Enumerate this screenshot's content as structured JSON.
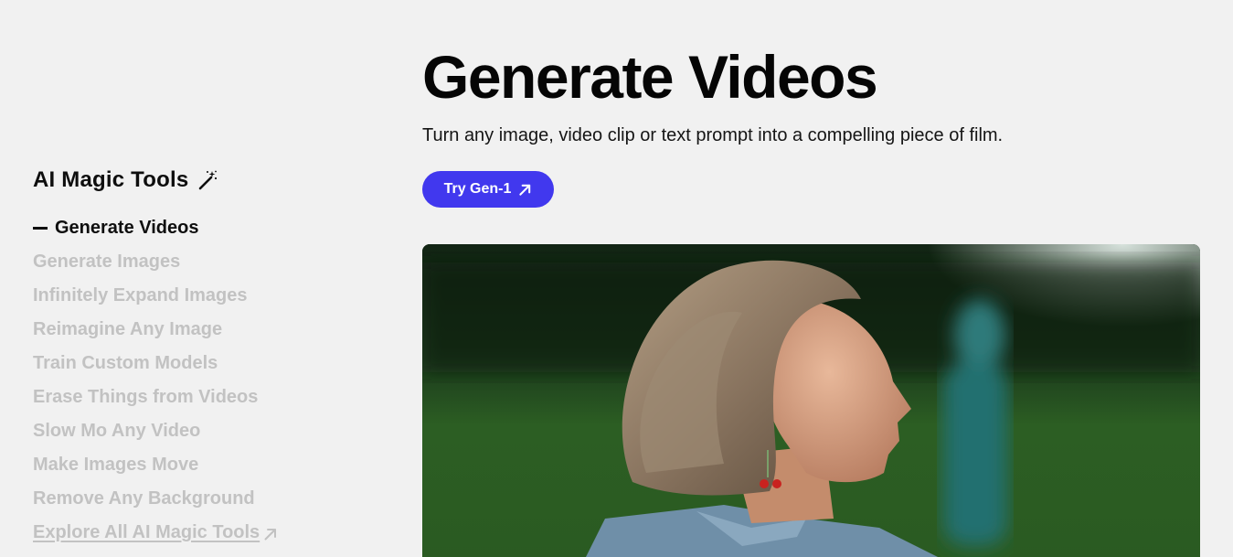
{
  "sidebar": {
    "title": "AI Magic Tools",
    "title_icon": "magic-wand-icon",
    "items": [
      {
        "label": "Generate Videos",
        "active": true
      },
      {
        "label": "Generate Images",
        "active": false
      },
      {
        "label": "Infinitely Expand Images",
        "active": false
      },
      {
        "label": "Reimagine Any Image",
        "active": false
      },
      {
        "label": "Train Custom Models",
        "active": false
      },
      {
        "label": "Erase Things from Videos",
        "active": false
      },
      {
        "label": "Slow Mo Any Video",
        "active": false
      },
      {
        "label": "Make Images Move",
        "active": false
      },
      {
        "label": "Remove Any Background",
        "active": false
      }
    ],
    "explore_label": "Explore All AI Magic Tools",
    "explore_icon": "external-arrow-icon"
  },
  "main": {
    "title": "Generate Videos",
    "subtitle": "Turn any image, video clip or text prompt into a compelling piece of film.",
    "cta_label": "Try Gen-1",
    "cta_icon": "external-arrow-icon",
    "video_description_icon": "video-preview"
  },
  "colors": {
    "background": "#f1f1f1",
    "accent": "#4138ee",
    "active_text": "#0e0e0e",
    "inactive_text": "#c2c2c2"
  }
}
